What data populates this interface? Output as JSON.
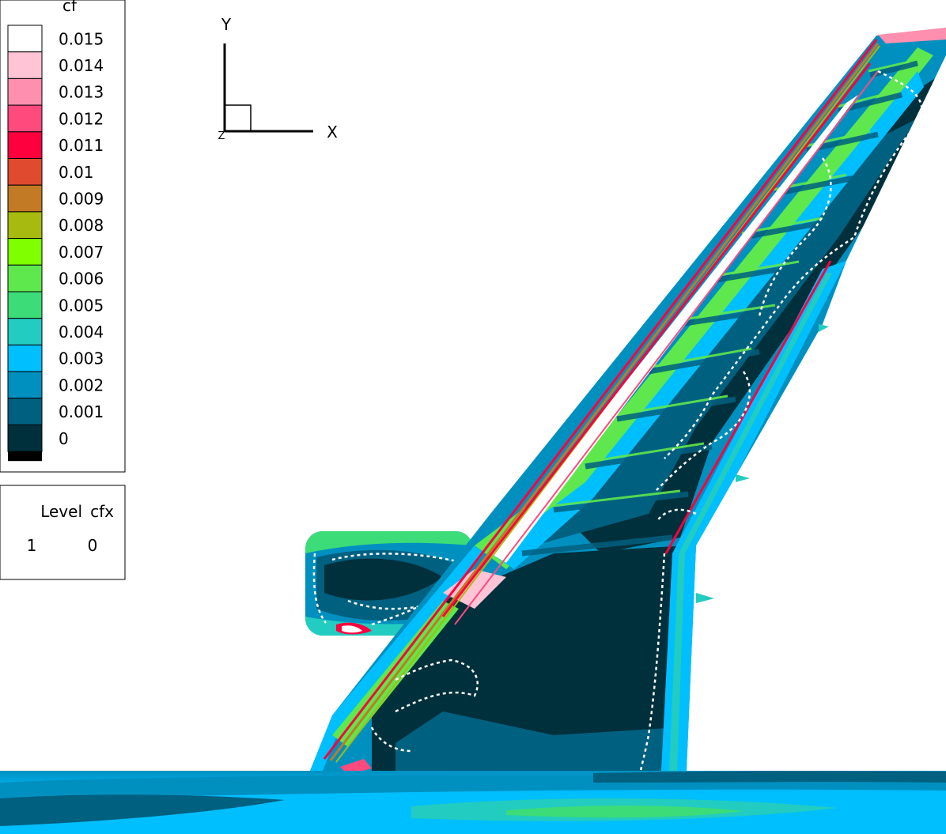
{
  "legend": {
    "title": "cf",
    "levels": [
      {
        "label": "0.015",
        "color": "#ffffff"
      },
      {
        "label": "0.014",
        "color": "#ffc4d6"
      },
      {
        "label": "0.013",
        "color": "#ff8fae"
      },
      {
        "label": "0.012",
        "color": "#ff4a7e"
      },
      {
        "label": "0.011",
        "color": "#ff003f"
      },
      {
        "label": "0.01",
        "color": "#e04a2e"
      },
      {
        "label": "0.009",
        "color": "#c27a24"
      },
      {
        "label": "0.008",
        "color": "#a7ba0f"
      },
      {
        "label": "0.007",
        "color": "#7fff00"
      },
      {
        "label": "0.006",
        "color": "#5ee84e"
      },
      {
        "label": "0.005",
        "color": "#3cdc78"
      },
      {
        "label": "0.004",
        "color": "#22ccc0"
      },
      {
        "label": "0.003",
        "color": "#00bfff"
      },
      {
        "label": "0.002",
        "color": "#0090c0"
      },
      {
        "label": "0.001",
        "color": "#006080"
      },
      {
        "label": "0",
        "color": "#00303c"
      }
    ],
    "bottom_color": "#000000"
  },
  "line_legend": {
    "col1": "Level",
    "col2": "cfx",
    "row_level": "1",
    "row_value": "0"
  },
  "axes": {
    "y_label": "Y",
    "x_label": "X",
    "z_label": "Z"
  }
}
